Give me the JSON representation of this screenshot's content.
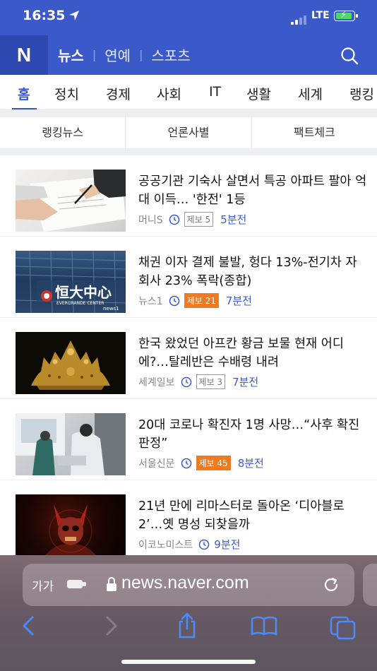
{
  "status_bar": {
    "time": "16:35",
    "network": "LTE",
    "battery_color": "#4cd964"
  },
  "header": {
    "logo": "N",
    "nav": [
      {
        "label": "뉴스",
        "active": true
      },
      {
        "label": "연예",
        "active": false
      },
      {
        "label": "스포츠",
        "active": false
      }
    ],
    "search_icon": "search-icon"
  },
  "categories": {
    "items": [
      "홈",
      "정치",
      "경제",
      "사회",
      "IT",
      "생활",
      "세계",
      "랭킹"
    ],
    "active": "홈"
  },
  "subtabs": [
    "랭킹뉴스",
    "언론사별",
    "팩트체크"
  ],
  "news": [
    {
      "title": "공공기관 기숙사 살면서 특공 아파트 팔아 억대 이득… '한전' 1등",
      "source": "머니S",
      "badge": "제보 5",
      "badge_hot": false,
      "time": "5분전"
    },
    {
      "title": "채권 이자 결제 불발, 헝다 13%-전기차 자회사 23% 폭락(종합)",
      "source": "뉴스1",
      "badge": "제보 21",
      "badge_hot": true,
      "time": "7분전"
    },
    {
      "title": "한국 왔었던 아프칸 황금 보물 현재 어디에?…탈레반은 수배령 내려",
      "source": "세계일보",
      "badge": "제보 3",
      "badge_hot": false,
      "time": "7분전"
    },
    {
      "title": "20대 코로나 확진자 1명 사망…“사후 확진 판정”",
      "source": "서울신문",
      "badge": "제보 45",
      "badge_hot": true,
      "time": "8분전"
    },
    {
      "title": "21년 만에 리마스터로 돌아온 ‘디아블로2’…옛 명성 되찾을까",
      "source": "이코노미스트",
      "badge": "",
      "badge_hot": false,
      "time": "9분전"
    }
  ],
  "thumb_text": {
    "evergrande_cn": "恒大中心",
    "evergrande_en": "EVERGRANDE CENTER",
    "news1_mark": "news1"
  },
  "safari": {
    "text_size": "가가",
    "url": "news.naver.com"
  },
  "colors": {
    "brand": "#3b59c9",
    "hot_badge": "#f07a21"
  }
}
